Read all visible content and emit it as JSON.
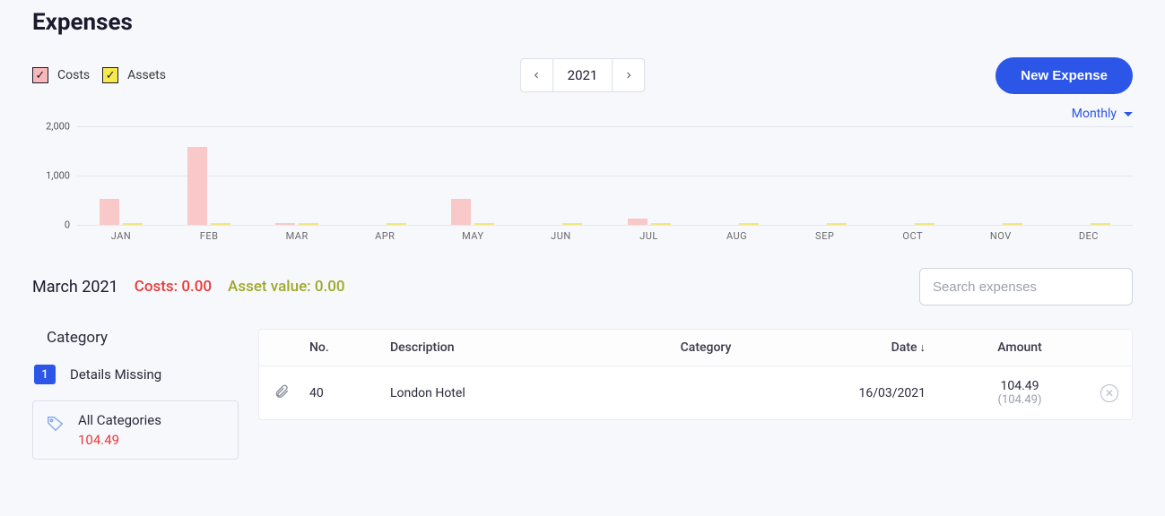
{
  "page_title": "Expenses",
  "legend": {
    "costs": "Costs",
    "assets": "Assets"
  },
  "year_picker": {
    "year": "2021"
  },
  "buttons": {
    "new_expense": "New Expense"
  },
  "granularity": {
    "label": "Monthly"
  },
  "chart_data": {
    "type": "bar",
    "categories": [
      "JAN",
      "FEB",
      "MAR",
      "APR",
      "MAY",
      "JUN",
      "JUL",
      "AUG",
      "SEP",
      "OCT",
      "NOV",
      "DEC"
    ],
    "series": [
      {
        "name": "Costs",
        "color": "#f9c9c9",
        "values": [
          520,
          1580,
          20,
          0,
          520,
          0,
          130,
          0,
          0,
          0,
          0,
          0
        ]
      },
      {
        "name": "Assets",
        "color": "#f2e87a",
        "values": [
          30,
          30,
          30,
          30,
          30,
          30,
          30,
          30,
          30,
          30,
          30,
          30
        ]
      }
    ],
    "y_ticks": [
      0,
      1000,
      2000
    ],
    "ylim": [
      0,
      2000
    ],
    "xlabel": "",
    "ylabel": "",
    "title": ""
  },
  "summary": {
    "month_label": "March 2021",
    "costs_label": "Costs: 0.00",
    "assets_label": "Asset value: 0.00"
  },
  "search": {
    "placeholder": "Search expenses"
  },
  "sidebar": {
    "title": "Category",
    "status": {
      "count": "1",
      "label": "Details Missing"
    },
    "category_card": {
      "name": "All Categories",
      "total": "104.49"
    }
  },
  "table": {
    "headers": {
      "attach": "",
      "no": "No.",
      "description": "Description",
      "category": "Category",
      "date": "Date",
      "amount": "Amount"
    },
    "rows": [
      {
        "no": "40",
        "description": "London Hotel",
        "category": "",
        "date": "16/03/2021",
        "amount_net": "104.49",
        "amount_gross": "(104.49)"
      }
    ]
  }
}
